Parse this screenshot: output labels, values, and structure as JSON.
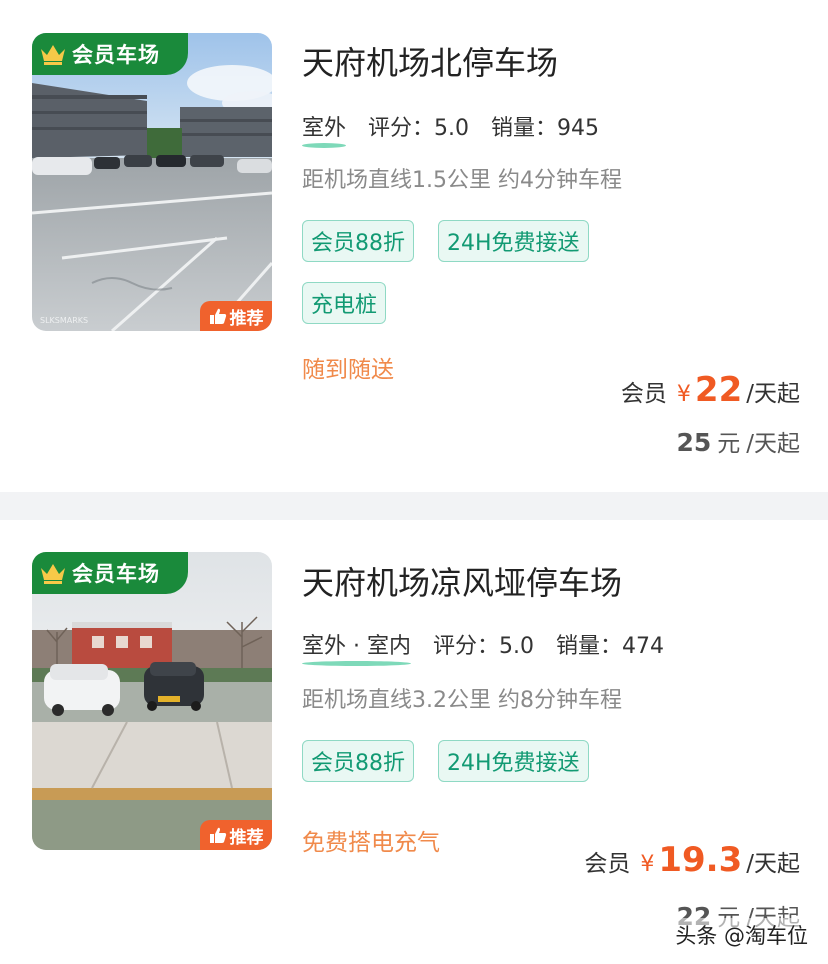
{
  "listings": [
    {
      "badge": "会员车场",
      "recommend": "推荐",
      "name": "天府机场北停车场",
      "location_type": "室外",
      "rating_label": "评分：5.0",
      "sales_label": "销量：945",
      "distance": "距机场直线1.5公里 约4分钟车程",
      "tags": [
        "会员88折",
        "24H免费接送",
        "充电桩"
      ],
      "feature": "随到随送",
      "member_label": "会员",
      "currency": "¥",
      "member_price": "22",
      "per_day": "/天起",
      "original_price": "25",
      "yuan": "元",
      "image_watermark": "SLKSMARKS"
    },
    {
      "badge": "会员车场",
      "recommend": "推荐",
      "name": "天府机场凉风垭停车场",
      "location_type": "室外 · 室内",
      "rating_label": "评分：5.0",
      "sales_label": "销量：474",
      "distance": "距机场直线3.2公里 约8分钟车程",
      "tags": [
        "会员88折",
        "24H免费接送"
      ],
      "feature": "免费搭电充气",
      "member_label": "会员",
      "currency": "¥",
      "member_price": "19.3",
      "per_day": "/天起",
      "original_price": "22",
      "yuan": "元"
    }
  ],
  "watermark": "头条 @淘车位",
  "icons": {
    "badge": "crown-icon",
    "recommend": "thumbs-up-icon"
  },
  "colors": {
    "badge_green": "#1a8a3b",
    "price_orange": "#f05a23",
    "feature_orange": "#f08a4b",
    "tag_green": "#129a73",
    "recommend_orange": "#f0622d"
  }
}
